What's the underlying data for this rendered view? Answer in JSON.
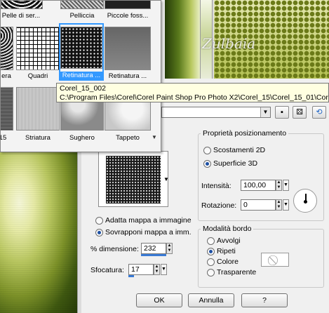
{
  "picker": {
    "items": [
      {
        "label": "Pelle di ser...",
        "texture": "t-pelle1"
      },
      {
        "label": "Pelliccia",
        "texture": "t-pelliccia"
      },
      {
        "label": "Piccole foss...",
        "texture": "t-fossili"
      },
      {
        "label": "era",
        "texture": "t-era"
      },
      {
        "label": "Quadri",
        "texture": "t-quadri"
      },
      {
        "label": "Retinatura ...",
        "texture": "t-retinatura",
        "selected": true
      },
      {
        "label": "Retinatura ...",
        "texture": "t-retinatura2"
      },
      {
        "label": "15",
        "texture": "t-15"
      },
      {
        "label": "Striatura",
        "texture": "t-striatura"
      },
      {
        "label": "Sughero",
        "texture": "t-sughero"
      },
      {
        "label": "Tappeto",
        "texture": "t-tappeto"
      }
    ],
    "scroll_arrow": "▼"
  },
  "tooltip": {
    "name": "Corel_15_002",
    "path": "C:\\Program Files\\Corel\\Corel Paint Shop Pro Photo X2\\Corel_15\\Corel_15_01\\Corel_1"
  },
  "watermark": "Zulbaia",
  "placement": {
    "title": "Proprietà posizionamento",
    "offset_2d": "Scostamenti 2D",
    "surface_3d": "Superficie 3D",
    "intensity_label": "Intensità:",
    "intensity_value": "100,00",
    "rotation_label": "Rotazione:",
    "rotation_value": "0"
  },
  "edge": {
    "title": "Modalità bordo",
    "wrap": "Avvolgi",
    "repeat": "Ripeti",
    "color": "Colore",
    "transparent": "Trasparente"
  },
  "mapping": {
    "fit": "Adatta mappa a immagine",
    "overlay": "Sovrapponi mappa a imm.",
    "size_label": "% dimensione:",
    "size_value": "232",
    "blur_label": "Sfocatura:",
    "blur_value": "17"
  },
  "buttons": {
    "ok": "OK",
    "cancel": "Annulla",
    "help": "?"
  }
}
